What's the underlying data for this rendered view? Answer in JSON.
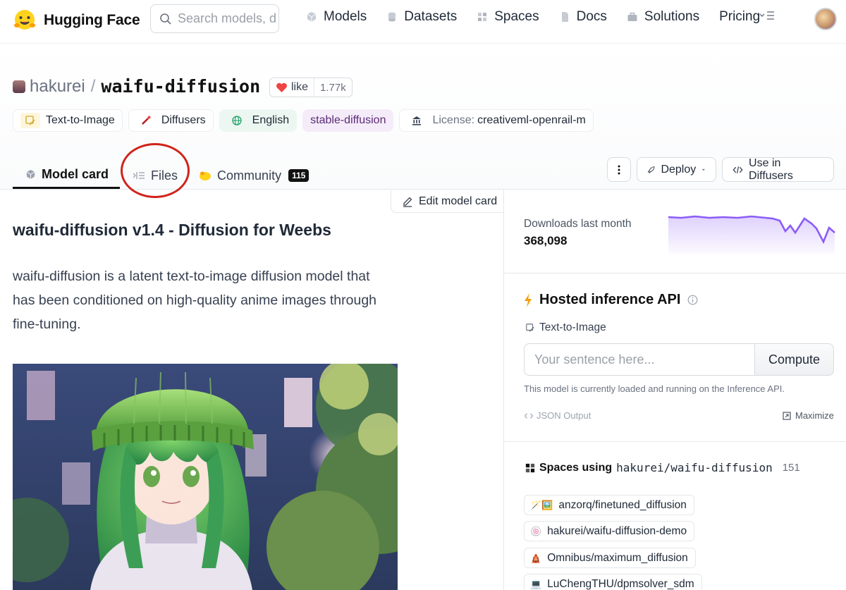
{
  "nav": {
    "brand": "Hugging Face",
    "search_placeholder": "Search models, datasets, users...",
    "links": [
      {
        "label": "Models",
        "icon": "cube-icon"
      },
      {
        "label": "Datasets",
        "icon": "database-icon"
      },
      {
        "label": "Spaces",
        "icon": "grid-icon"
      },
      {
        "label": "Docs",
        "icon": "document-icon"
      },
      {
        "label": "Solutions",
        "icon": "briefcase-icon"
      },
      {
        "label": "Pricing",
        "icon": ""
      }
    ]
  },
  "repo": {
    "owner": "hakurei",
    "separator": "/",
    "name": "waifu-diffusion",
    "like_label": "like",
    "like_count": "1.77k"
  },
  "tags": [
    {
      "label": "Text-to-Image",
      "icon": "text-to-image-icon"
    },
    {
      "label": "Diffusers",
      "icon": "diffusers-icon"
    },
    {
      "label": "English",
      "icon": "globe-icon"
    },
    {
      "label": "stable-diffusion",
      "icon": ""
    }
  ],
  "license": {
    "label": "License:",
    "value": "creativeml-openrail-m"
  },
  "tabs": [
    {
      "label": "Model card",
      "active": true
    },
    {
      "label": "Files",
      "active": false
    },
    {
      "label": "Community",
      "active": false,
      "badge": "115"
    }
  ],
  "header_buttons": {
    "deploy": "Deploy",
    "use_in": "Use in Diffusers"
  },
  "card": {
    "edit_label": "Edit model card",
    "title": "waifu-diffusion v1.4 - Diffusion for Weebs",
    "description": "waifu-diffusion is a latent text-to-image diffusion model that has been conditioned on high-quality anime images through fine-tuning."
  },
  "downloads": {
    "label": "Downloads last month",
    "value": "368,098"
  },
  "inference": {
    "title": "Hosted inference API",
    "task": "Text-to-Image",
    "placeholder": "Your sentence here...",
    "compute": "Compute",
    "note": "This model is currently loaded and running on the Inference API.",
    "json_output": "JSON Output",
    "maximize": "Maximize"
  },
  "spaces": {
    "title_prefix": "Spaces using",
    "repo": "hakurei/waifu-diffusion",
    "count": "151",
    "items": [
      {
        "name": "anzorq/finetuned_diffusion",
        "emoji": "🪄🖼️"
      },
      {
        "name": "hakurei/waifu-diffusion-demo",
        "emoji": "🍥"
      },
      {
        "name": "Omnibus/maximum_diffusion",
        "emoji": "🛕"
      },
      {
        "name": "LuChengTHU/dpmsolver_sdm",
        "emoji": "💻"
      }
    ]
  },
  "colors": {
    "accent_purple": "#8b5cf6",
    "like_heart": "#ef4444",
    "annotation_red": "#d0241b"
  }
}
